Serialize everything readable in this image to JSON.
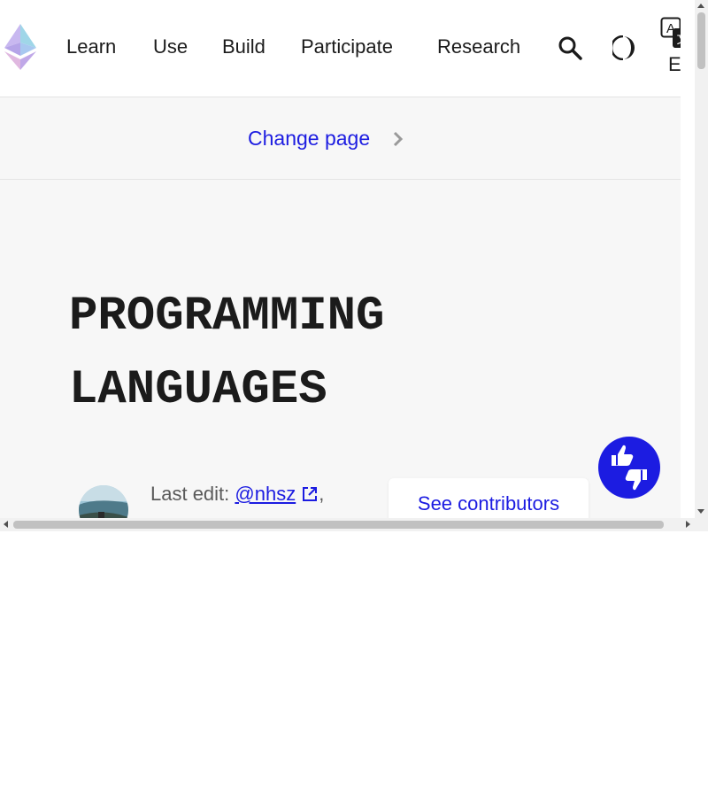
{
  "nav": {
    "items": [
      {
        "label": "Learn"
      },
      {
        "label": "Use"
      },
      {
        "label": "Build"
      },
      {
        "label": "Participate"
      },
      {
        "label": "Research"
      }
    ],
    "language_code": "EN"
  },
  "change_page": {
    "label": "Change page"
  },
  "page": {
    "title": "PROGRAMMING LANGUAGES"
  },
  "last_edit": {
    "prefix": "Last edit: ",
    "author": "@nhsz",
    "suffix": ","
  },
  "contributors_button": {
    "label": "See contributors"
  },
  "icons": {
    "logo": "ethereum-logo-icon",
    "search": "search-icon",
    "theme": "dark-mode-moon-icon",
    "language": "translate-icon",
    "chevron": "chevron-right-icon",
    "external": "external-link-icon",
    "feedback": "thumbs-up-down-icon"
  },
  "colors": {
    "accent": "#1c1ce1",
    "text": "#1b1b1b",
    "background": "#f7f7f7"
  }
}
